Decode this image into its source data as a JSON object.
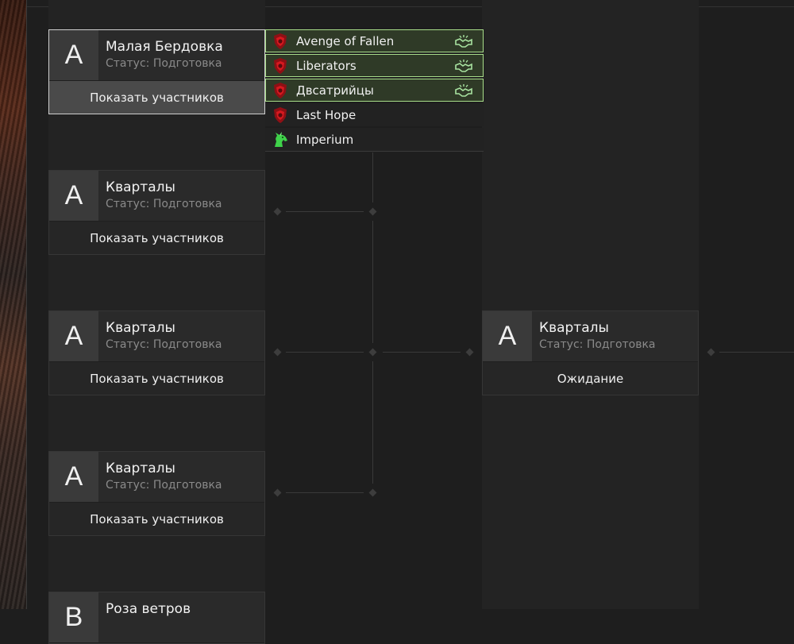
{
  "bracket": {
    "round1": [
      {
        "letter": "А",
        "name": "Малая Бердовка",
        "status": "Статус: Подготовка",
        "button": "Показать участников"
      },
      {
        "letter": "А",
        "name": "Кварталы",
        "status": "Статус: Подготовка",
        "button": "Показать участников"
      },
      {
        "letter": "А",
        "name": "Кварталы",
        "status": "Статус: Подготовка",
        "button": "Показать участников"
      },
      {
        "letter": "А",
        "name": "Кварталы",
        "status": "Статус: Подготовка",
        "button": "Показать участников"
      },
      {
        "letter": "В",
        "name": "Роза ветров"
      }
    ],
    "round2": [
      {
        "letter": "А",
        "name": "Кварталы",
        "status": "Статус: Подготовка",
        "button": "Ожидание"
      }
    ]
  },
  "participants": [
    {
      "name": "Avenge of Fallen",
      "icon": "red-shield-icon",
      "ally": true
    },
    {
      "name": "Liberators",
      "icon": "red-shield-icon",
      "ally": true
    },
    {
      "name": "Двсатрийцы",
      "icon": "red-shield-icon",
      "ally": true
    },
    {
      "name": "Last Hope",
      "icon": "red-shield-icon",
      "ally": false
    },
    {
      "name": "Imperium",
      "icon": "green-unicorn-icon",
      "ally": false
    }
  ],
  "colors": {
    "ally_border": "#a8dd8a",
    "ally_bg": "#2f3a27",
    "shield_red": "#c0161c",
    "unicorn_green": "#3fd24a"
  }
}
